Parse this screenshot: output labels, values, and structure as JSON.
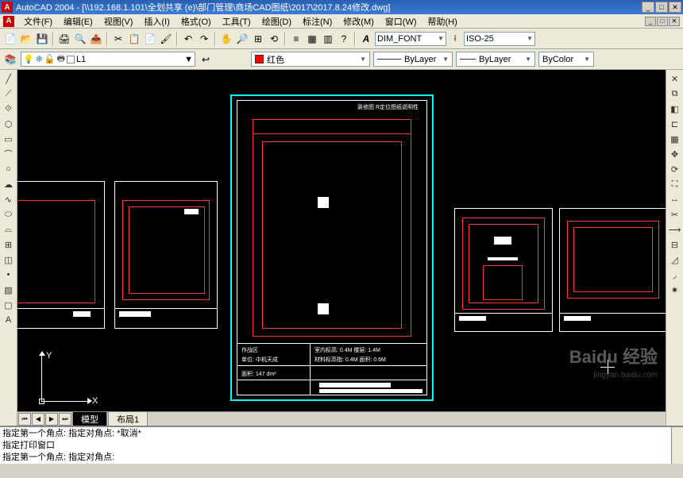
{
  "title": "AutoCAD 2004 - [\\\\192.168.1.101\\全划共享 (e)\\部门管理\\商场CAD图纸\\2017\\2017.8.24修改.dwg]",
  "menu": {
    "file": "文件(F)",
    "edit": "编辑(E)",
    "view": "视图(V)",
    "insert": "插入(I)",
    "format": "格式(O)",
    "tools": "工具(T)",
    "draw": "绘图(D)",
    "dimension": "标注(N)",
    "modify": "修改(M)",
    "window": "窗口(W)",
    "help": "帮助(H)"
  },
  "toolbar2": {
    "fontcombo": "DIM_FONT",
    "dimcombo": "ISO-25"
  },
  "props": {
    "layer": "L1",
    "color": "红色",
    "linetype": "ByLayer",
    "lineweight": "ByLayer",
    "plotstyle": "ByColor"
  },
  "tabs": {
    "model": "模型",
    "layout1": "布局1"
  },
  "ucs": {
    "x": "X",
    "y": "Y"
  },
  "command": {
    "line1": "指定第一个角点: 指定对角点: *取消*",
    "line2": "指定打印窗口",
    "line3": "指定第一个角点: 指定对角点:"
  },
  "watermark": {
    "main": "Baidu 经验",
    "sub": "jingyan.baidu.com"
  },
  "drawing": {
    "center_header": "装修图  R定位图纸说明性",
    "info1": "作战区",
    "info2": "单位: 中机天成",
    "info3": "面积: 147 dm²",
    "info4": "室内标高: 0.4M    楼层: 1.4M",
    "info5": "材料标高指: 0.4M    面积: 0.6M"
  }
}
